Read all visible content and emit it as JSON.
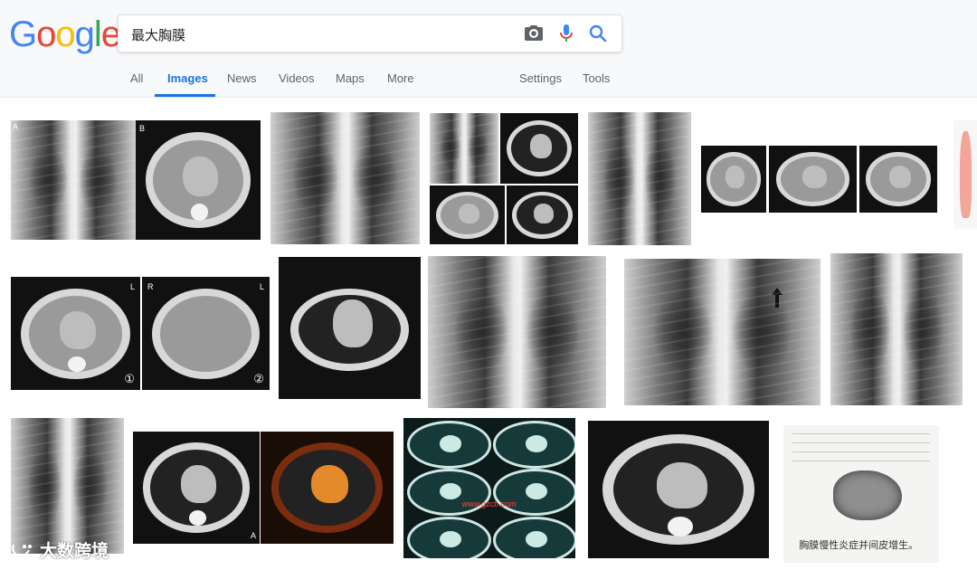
{
  "search": {
    "query": "最大胸膜"
  },
  "logo": {
    "letters": [
      "G",
      "o",
      "o",
      "g",
      "l",
      "e"
    ],
    "colors": [
      "#4285F4",
      "#EA4335",
      "#FBBC05",
      "#4285F4",
      "#34A853",
      "#EA4335"
    ]
  },
  "icons": {
    "camera": "camera-icon",
    "mic": "microphone-icon",
    "search": "search-icon"
  },
  "tabs": [
    {
      "label": "All"
    },
    {
      "label": "Images"
    },
    {
      "label": "News"
    },
    {
      "label": "Videos"
    },
    {
      "label": "Maps"
    },
    {
      "label": "More"
    },
    {
      "label": "Settings"
    },
    {
      "label": "Tools"
    }
  ],
  "active_tab": "Images",
  "results": {
    "labels": {
      "a": "A",
      "b": "B",
      "l": "L",
      "r": "R",
      "c1": "①",
      "c2": "②"
    },
    "caption_tissue": "胸膜慢性炎症并间皮增生。",
    "overlay_text": "www.gzcb.com"
  },
  "watermark": {
    "text": "大数跨境"
  },
  "colors": {
    "accent": "#1a73e8",
    "header_bg": "#f8f9fa",
    "tab_text": "#5f6368"
  }
}
